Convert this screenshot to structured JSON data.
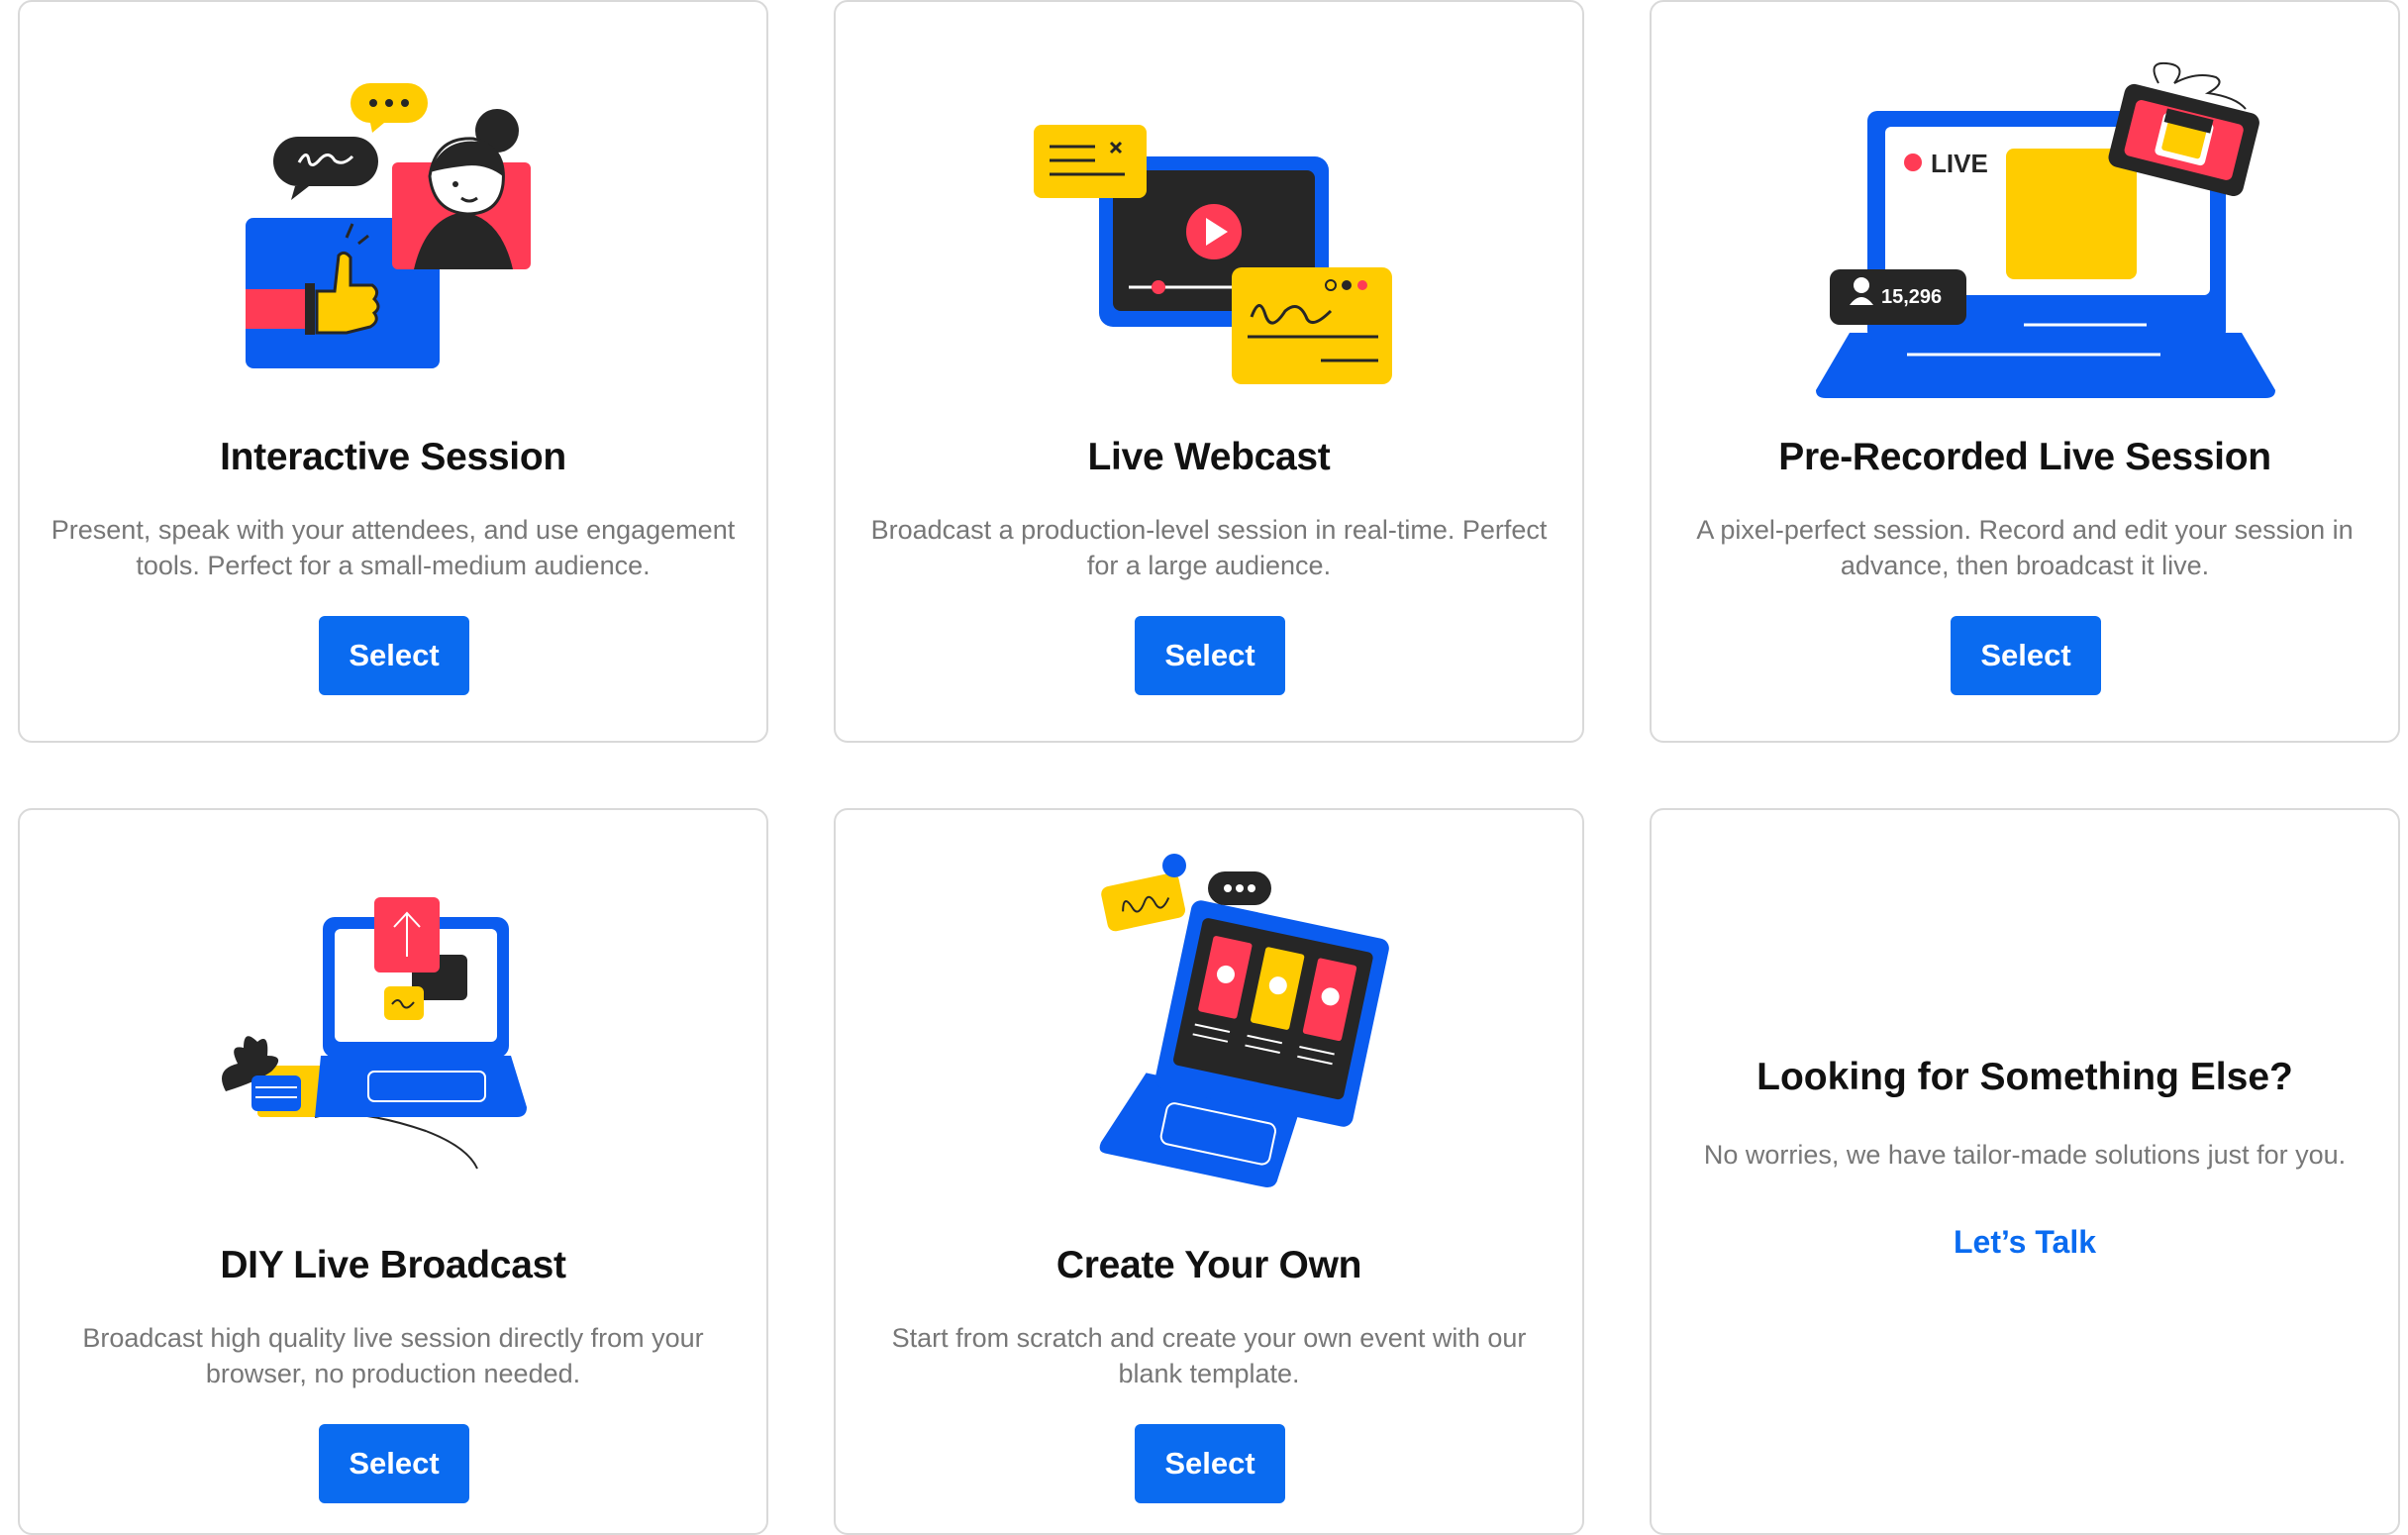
{
  "cards": [
    {
      "title": "Interactive Session",
      "description": "Present, speak with your attendees, and use engagement tools. Perfect for a small-medium audience.",
      "button_label": "Select",
      "illustration": "interactive-session-illustration"
    },
    {
      "title": "Live Webcast",
      "description": "Broadcast a production-level session in real-time. Perfect for a large audience.",
      "button_label": "Select",
      "illustration": "live-webcast-illustration"
    },
    {
      "title": "Pre-Recorded Live Session",
      "description": "A pixel-perfect session. Record and edit your session in advance, then broadcast it live.",
      "button_label": "Select",
      "illustration": "pre-recorded-illustration",
      "live_label": "LIVE",
      "viewer_count": "15,296"
    },
    {
      "title": "DIY Live Broadcast",
      "description": "Broadcast high quality live session directly from your browser, no production needed.",
      "button_label": "Select",
      "illustration": "diy-broadcast-illustration"
    },
    {
      "title": "Create Your Own",
      "description": "Start from scratch and create your own event with our blank template.",
      "button_label": "Select",
      "illustration": "create-your-own-illustration"
    }
  ],
  "cta": {
    "title": "Looking for Something Else?",
    "description": "No worries, we have tailor-made solutions just for you.",
    "link_label": "Let’s Talk"
  },
  "colors": {
    "accent_blue": "#0a6bf0",
    "illustration_blue": "#0a5cf0",
    "yellow": "#ffcc00",
    "red": "#ff3b55",
    "dark": "#262626",
    "border": "#d9d9d9"
  }
}
